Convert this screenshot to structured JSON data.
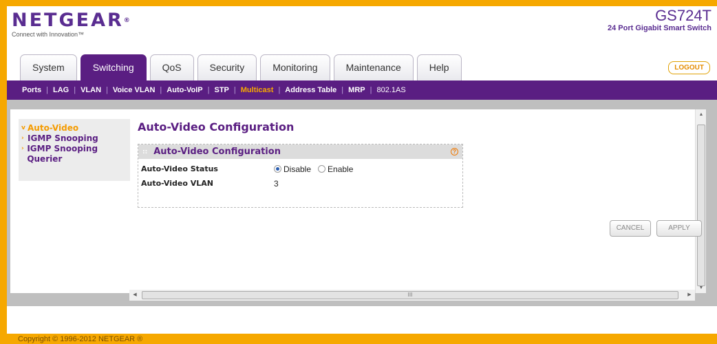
{
  "brand": {
    "logo_text": "NETGEAR",
    "tagline": "Connect with Innovation™",
    "model": "GS724T",
    "model_desc": "24 Port Gigabit Smart Switch"
  },
  "tabs": [
    {
      "label": "System",
      "active": false
    },
    {
      "label": "Switching",
      "active": true
    },
    {
      "label": "QoS",
      "active": false
    },
    {
      "label": "Security",
      "active": false
    },
    {
      "label": "Monitoring",
      "active": false
    },
    {
      "label": "Maintenance",
      "active": false
    },
    {
      "label": "Help",
      "active": false
    }
  ],
  "logout_label": "LOGOUT",
  "subnav": [
    {
      "label": "Ports",
      "active": false
    },
    {
      "label": "LAG",
      "active": false
    },
    {
      "label": "VLAN",
      "active": false
    },
    {
      "label": "Voice VLAN",
      "active": false
    },
    {
      "label": "Auto-VoIP",
      "active": false
    },
    {
      "label": "STP",
      "active": false
    },
    {
      "label": "Multicast",
      "active": true
    },
    {
      "label": "Address Table",
      "active": false
    },
    {
      "label": "MRP",
      "active": false
    },
    {
      "label": "802.1AS",
      "active": false
    }
  ],
  "leftnav": [
    {
      "label": "Auto-Video",
      "active": true
    },
    {
      "label": "IGMP Snooping",
      "active": false
    },
    {
      "label": "IGMP Snooping Querier",
      "active": false
    }
  ],
  "page_title": "Auto-Video Configuration",
  "panel": {
    "title": "Auto-Video Configuration",
    "status_label": "Auto-Video Status",
    "status_options": [
      {
        "label": "Disable",
        "selected": true
      },
      {
        "label": "Enable",
        "selected": false
      }
    ],
    "vlan_label": "Auto-Video VLAN",
    "vlan_value": "3"
  },
  "hscroll_grip": "III",
  "buttons": {
    "cancel": "CANCEL",
    "apply": "APPLY"
  },
  "copyright": "Copyright © 1996-2012 NETGEAR ®",
  "colors": {
    "brand_purple": "#5a1e82",
    "accent_orange": "#f6a800"
  }
}
